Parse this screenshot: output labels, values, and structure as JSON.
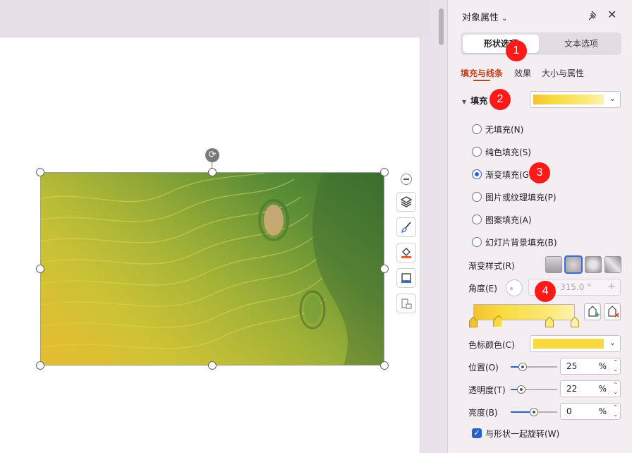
{
  "pane": {
    "title": "对象属性",
    "tabs": {
      "shape": "形状选项",
      "text": "文本选项"
    },
    "subtabs": {
      "fill_line": "填充与线条",
      "effect": "效果",
      "size": "大小与属性"
    },
    "fill_section": {
      "header": "填充",
      "options": [
        {
          "label": "无填充(N)",
          "selected": false
        },
        {
          "label": "纯色填充(S)",
          "selected": false
        },
        {
          "label": "渐变填充(G)",
          "selected": true
        },
        {
          "label": "图片或纹理填充(P)",
          "selected": false
        },
        {
          "label": "图案填充(A)",
          "selected": false
        },
        {
          "label": "幻灯片背景填充(B)",
          "selected": false
        }
      ]
    },
    "gradient_style_label": "渐变样式(R)",
    "angle_label": "角度(E)",
    "angle_value": "315.0 °",
    "angle_plus": "+",
    "stop_color_label": "色标颜色(C)",
    "stop_color_hex": "#f9d93c",
    "position_label": "位置(O)",
    "position_value": "25",
    "transparency_label": "透明度(T)",
    "transparency_value": "22",
    "brightness_label": "亮度(B)",
    "brightness_value": "0",
    "percent": "%",
    "rotate_with_shape_label": "与形状一起旋转(W)",
    "rotate_with_shape_checked": true,
    "sliders": {
      "position": 0.25,
      "transparency": 0.22,
      "brightness": 0.5
    }
  },
  "gradient_stops": [
    {
      "position": 0.0,
      "color": "#f2c230"
    },
    {
      "position": 0.25,
      "color": "#f9d93c"
    },
    {
      "position": 0.75,
      "color": "#fbe979"
    },
    {
      "position": 1.0,
      "color": "#fdf3b0"
    }
  ],
  "callouts": [
    "1",
    "2",
    "3",
    "4"
  ],
  "colors": {
    "accent": "#c0431b",
    "selection_blue": "#2a62c8",
    "callout_red": "#ff1a1a"
  },
  "icons": {
    "float_toolbar": [
      "layers-icon",
      "brush-icon",
      "fill-color-icon",
      "frame-icon",
      "chart-icon"
    ],
    "pane": [
      "pin-icon",
      "close-icon",
      "chevron-down-icon"
    ]
  }
}
